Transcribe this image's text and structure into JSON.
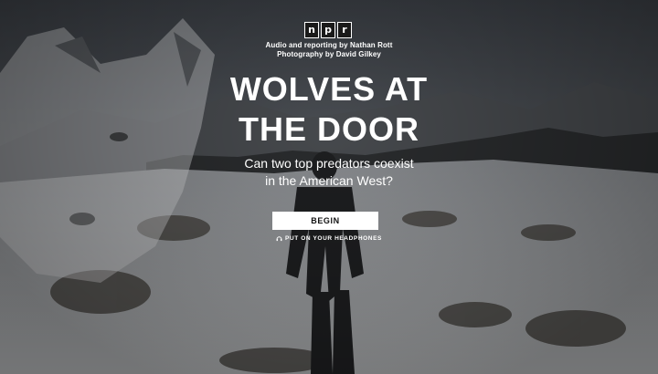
{
  "logo": {
    "letters": [
      "n",
      "p",
      "r"
    ]
  },
  "credits": {
    "audio": "Audio and reporting by Nathan Rott",
    "photo": "Photography by David Gilkey"
  },
  "story": {
    "title_line1": "WOLVES AT",
    "title_line2": "THE DOOR",
    "subtitle_line1": "Can two top predators coexist",
    "subtitle_line2": "in the American West?"
  },
  "begin_button": {
    "label": "BEGIN"
  },
  "hint": {
    "icon": "headphones-icon",
    "text": "PUT ON YOUR HEADPHONES"
  },
  "colors": {
    "button_bg": "#ffffff",
    "text": "#ffffff",
    "button_text": "#111111"
  }
}
